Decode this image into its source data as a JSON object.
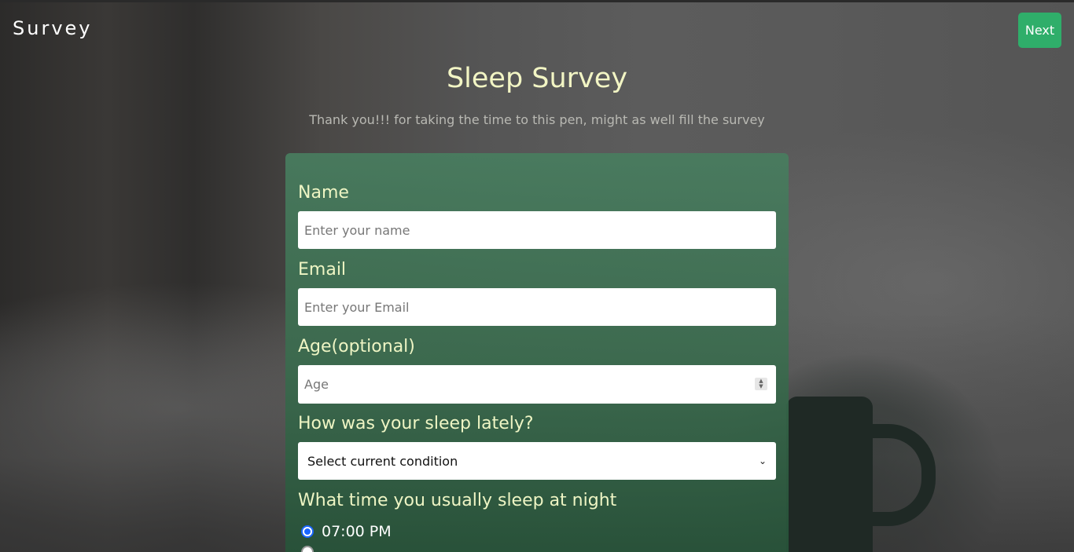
{
  "header": {
    "logo": "Survey",
    "next_label": "Next",
    "accent_color": "#2fae6a"
  },
  "page": {
    "title": "Sleep Survey",
    "subtitle": "Thank you!!! for taking the time to this pen, might as well fill the survey"
  },
  "form": {
    "name": {
      "label": "Name",
      "placeholder": "Enter your name",
      "value": ""
    },
    "email": {
      "label": "Email",
      "placeholder": "Enter your Email",
      "value": ""
    },
    "age": {
      "label": "Age(optional)",
      "placeholder": "Age",
      "value": ""
    },
    "sleep_condition": {
      "label": "How was your sleep lately?",
      "selected": "Select current condition",
      "icon": "chevron-down-icon"
    },
    "sleep_time": {
      "label": "What time you usually sleep at night",
      "options": [
        {
          "label": "07:00 PM",
          "checked": true
        },
        {
          "label": "",
          "checked": false
        }
      ]
    }
  }
}
